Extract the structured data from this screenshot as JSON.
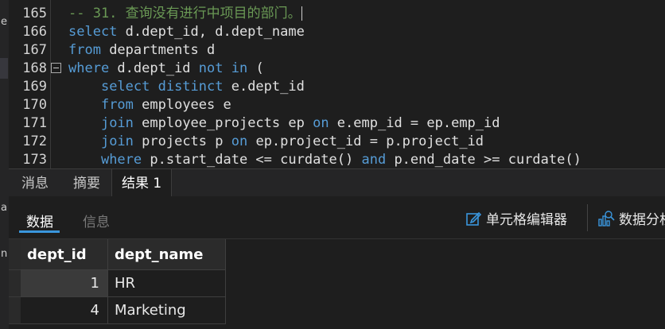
{
  "editor": {
    "lines": [
      {
        "num": "165",
        "parts": [
          {
            "c": "cm",
            "t": "-- 31. 查询没有进行中项目的部门。"
          }
        ]
      },
      {
        "num": "166",
        "parts": [
          {
            "c": "kw",
            "t": "select"
          },
          {
            "c": "tx",
            "t": " d.dept_id, d.dept_name"
          }
        ]
      },
      {
        "num": "167",
        "parts": [
          {
            "c": "kw",
            "t": "from"
          },
          {
            "c": "tx",
            "t": " departments d"
          }
        ]
      },
      {
        "num": "168",
        "parts": [
          {
            "c": "kw",
            "t": "where"
          },
          {
            "c": "tx",
            "t": " d.dept_id "
          },
          {
            "c": "kw",
            "t": "not in"
          },
          {
            "c": "tx",
            "t": " ("
          }
        ]
      },
      {
        "num": "169",
        "parts": [
          {
            "c": "tx",
            "t": "    "
          },
          {
            "c": "kw",
            "t": "select distinct"
          },
          {
            "c": "tx",
            "t": " e.dept_id"
          }
        ]
      },
      {
        "num": "170",
        "parts": [
          {
            "c": "tx",
            "t": "    "
          },
          {
            "c": "kw",
            "t": "from"
          },
          {
            "c": "tx",
            "t": " employees e"
          }
        ]
      },
      {
        "num": "171",
        "parts": [
          {
            "c": "tx",
            "t": "    "
          },
          {
            "c": "kw",
            "t": "join"
          },
          {
            "c": "tx",
            "t": " employee_projects ep "
          },
          {
            "c": "kw",
            "t": "on"
          },
          {
            "c": "tx",
            "t": " e.emp_id = ep.emp_id"
          }
        ]
      },
      {
        "num": "172",
        "parts": [
          {
            "c": "tx",
            "t": "    "
          },
          {
            "c": "kw",
            "t": "join"
          },
          {
            "c": "tx",
            "t": " projects p "
          },
          {
            "c": "kw",
            "t": "on"
          },
          {
            "c": "tx",
            "t": " ep.project_id = p.project_id"
          }
        ]
      },
      {
        "num": "173",
        "parts": [
          {
            "c": "tx",
            "t": "    "
          },
          {
            "c": "kw",
            "t": "where"
          },
          {
            "c": "tx",
            "t": " p.start_date <= curdate() "
          },
          {
            "c": "kw",
            "t": "and"
          },
          {
            "c": "tx",
            "t": " p.end_date >= curdate()"
          }
        ]
      }
    ]
  },
  "left_strip": {
    "chars": [
      "e",
      "a",
      "n"
    ]
  },
  "tabs": [
    {
      "label": "消息"
    },
    {
      "label": "摘要"
    },
    {
      "label": "结果 1"
    }
  ],
  "subtabs": {
    "data": "数据",
    "info": "信息"
  },
  "toolbar": {
    "cell_editor": "单元格编辑器",
    "data_analysis": "数据分析"
  },
  "table": {
    "columns": [
      "dept_id",
      "dept_name"
    ],
    "rows": [
      {
        "dept_id": "1",
        "dept_name": "HR"
      },
      {
        "dept_id": "4",
        "dept_name": "Marketing"
      }
    ]
  },
  "colors": {
    "accent": "#3a96dd",
    "keyword": "#569cd6",
    "comment": "#6a9955"
  }
}
